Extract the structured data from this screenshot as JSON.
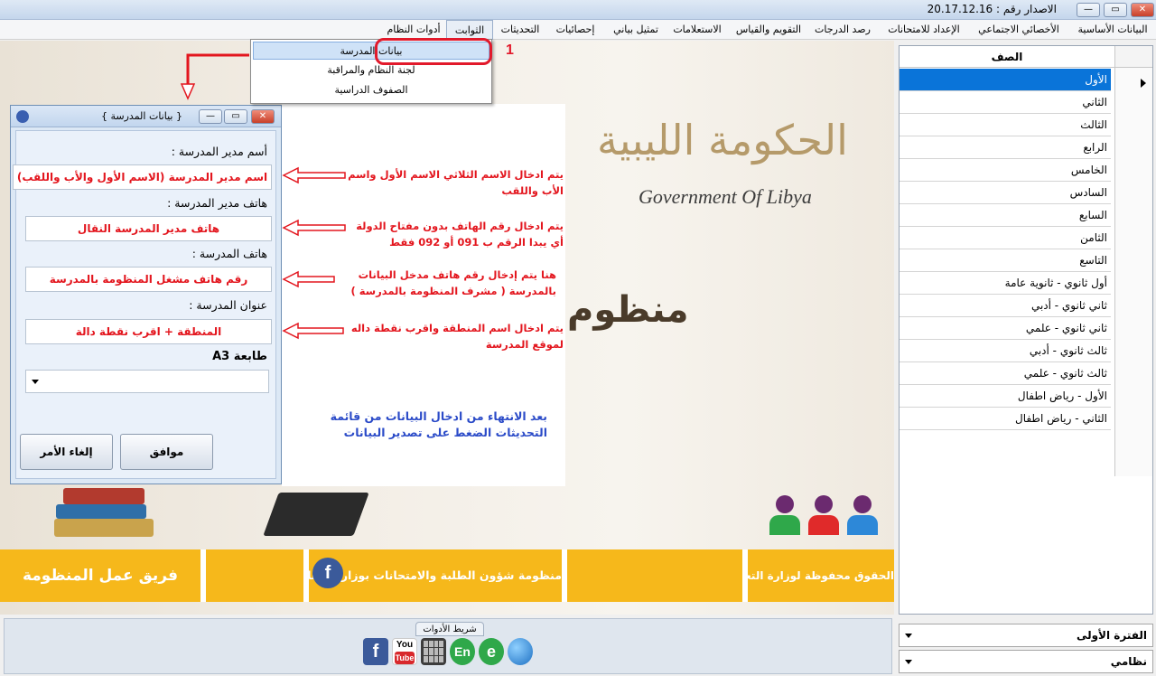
{
  "window": {
    "title": "الاصدار رقم : 20.17.12.16",
    "buttons": {
      "close": "✕",
      "maximize": "▭",
      "minimize": "—"
    }
  },
  "menu": {
    "items": [
      "البيانات الأساسية",
      "الأخصائي الاجتماعي",
      "الإعداد للامتحانات",
      "رصد الدرجات",
      "التقويم والقياس",
      "الاستعلامات",
      "تمثيل بياني",
      "إحصائيات",
      "التحديثات",
      "الثوابت",
      "أدوات النظام"
    ],
    "dropdown": [
      "بيانات المدرسة",
      "لجنة النظام والمراقبة",
      "الصفوف الدراسية"
    ],
    "step_marker": "1"
  },
  "grades": {
    "header": "الصف",
    "rows": [
      "الأول",
      "الثاني",
      "الثالث",
      "الرابع",
      "الخامس",
      "السادس",
      "السابع",
      "الثامن",
      "التاسع",
      "أول ثانوي - ثانوية عامة",
      "ثاني ثانوي - أدبي",
      "ثاني ثانوي - علمي",
      "ثالث ثانوي - أدبي",
      "ثالث ثانوي - علمي",
      "الأول - رياض اطفال",
      "الثاني - رياض اطفال"
    ],
    "selected_index": 0
  },
  "combos": {
    "period": "الفترة الأولى",
    "system": "نظامي"
  },
  "logo": {
    "arabic": "الحكومة الليبية",
    "english": "Government Of Libya",
    "partial_text": "منظوم"
  },
  "dialog": {
    "title": "{ بيانات المدرسة }",
    "fields": [
      {
        "label": "أسم مدير المدرسة  :",
        "value": "اسم مدير المدرسة (الاسم الأول والأب واللقب)"
      },
      {
        "label": "هاتف مدير المدرسة  :",
        "value": "هاتف مدير المدرسة النقال"
      },
      {
        "label": "هاتف المدرسة :",
        "value": "رقم هاتف مشغل المنظومة بالمدرسة"
      },
      {
        "label": "عنوان المدرسة :",
        "value": "المنطقة + اقرب نقطة دالة"
      }
    ],
    "print_label": "طابعة A3",
    "ok": "موافق",
    "cancel": "إلغاء الأمر"
  },
  "notes": {
    "n1": "يتم ادخال الاسم الثلاثي الاسم الأول واسم الأب واللقب",
    "n2": "يتم ادخال رقم الهاتف بدون مفتاح الدولة أي يبدا الرقم ب 091 أو 092 فقط",
    "n3": "هنا يتم إدخال رقم هاتف مدخل البيانات بالمدرسة  ( مشرف المنظومة بالمدرسة )",
    "n4": "يتم ادخال اسم المنطقة واقرب نقطة داله لموقع المدرسة",
    "n5": "بعد الانتهاء من ادخال البيانات من قائمة التحديثات الضغط على تصدير البيانات"
  },
  "banner": {
    "b1": "الحقوق محفوظة لوزارة التعليم",
    "b2": "منظومة شؤون الطلبة والامتحانات بوزارة التعليم",
    "b3": "فريق عمل المنظومة",
    "fb": "f"
  },
  "toolbar": {
    "label": "شريط الأدوات",
    "icons": [
      "facebook-icon",
      "youtube-icon",
      "calculator-icon",
      "english-icon",
      "internet-explorer-icon",
      "globe-icon"
    ],
    "yt": "You",
    "en": "En",
    "e": "e"
  },
  "colors": {
    "accent_red": "#e3161e",
    "selection_blue": "#0a74d9",
    "banner_yellow": "#f6b81b"
  }
}
